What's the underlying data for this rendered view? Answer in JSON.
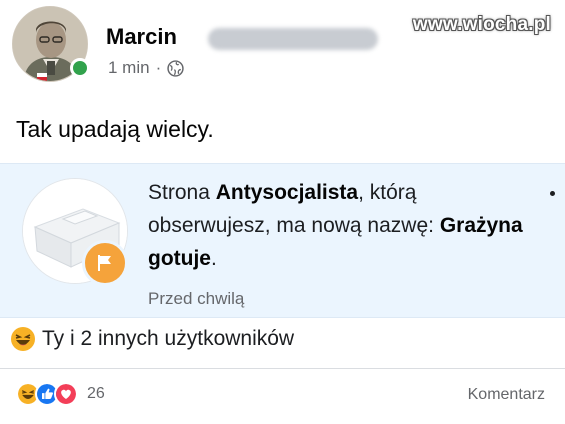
{
  "watermark": "www.wiocha.pl",
  "post": {
    "author": "Marcin",
    "time": "1 min",
    "separator": "·",
    "audience_icon": "globe-icon",
    "text": "Tak upadają wielcy."
  },
  "notification": {
    "part1": "Strona ",
    "page_name": "Antysocjalista",
    "part2": ", którą obserwujesz, ma nową nazwę: ",
    "new_name": "Grażyna gotuje",
    "part3": ".",
    "time": "Przed chwilą",
    "badge_icon": "flag-icon",
    "badge_color": "#f5a33b"
  },
  "likes": {
    "icon": "haha-reaction-icon",
    "text": "Ty i 2 innych użytkowników"
  },
  "footer": {
    "reaction_icons": [
      "haha-reaction-icon",
      "like-reaction-icon",
      "love-reaction-icon"
    ],
    "count": "26",
    "comment_label": "Komentarz"
  },
  "colors": {
    "notification_bg": "#ebf5fe",
    "online": "#31a24c",
    "like": "#1877f2",
    "love": "#f33e58",
    "haha": "#f7b125"
  }
}
